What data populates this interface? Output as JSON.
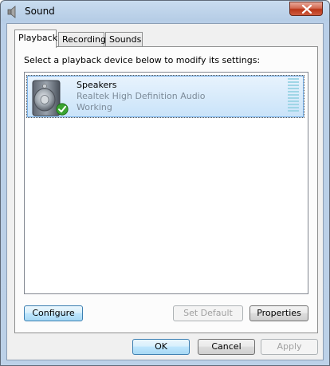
{
  "window": {
    "title": "Sound",
    "icon": "speaker-icon",
    "close_icon": "close-icon"
  },
  "tabs": [
    {
      "label": "Playback",
      "active": true
    },
    {
      "label": "Recording",
      "active": false
    },
    {
      "label": "Sounds",
      "active": false
    }
  ],
  "playback": {
    "instruction": "Select a playback device below to modify its settings:",
    "devices": [
      {
        "name": "Speakers",
        "description": "Realtek High Definition Audio",
        "status": "Working",
        "icon": "speaker-device-icon",
        "badge_icon": "default-checkmark-icon",
        "selected": true
      }
    ],
    "buttons": {
      "configure": "Configure",
      "set_default": "Set Default",
      "properties": "Properties"
    }
  },
  "dialog_buttons": {
    "ok": "OK",
    "cancel": "Cancel",
    "apply": "Apply"
  },
  "colors": {
    "selection_top": "#e8f3fd",
    "selection_bottom": "#c9e3f9",
    "secondary_text": "#7d8b99",
    "meter": "#9fd5e6",
    "close_button": "#c9452b"
  }
}
